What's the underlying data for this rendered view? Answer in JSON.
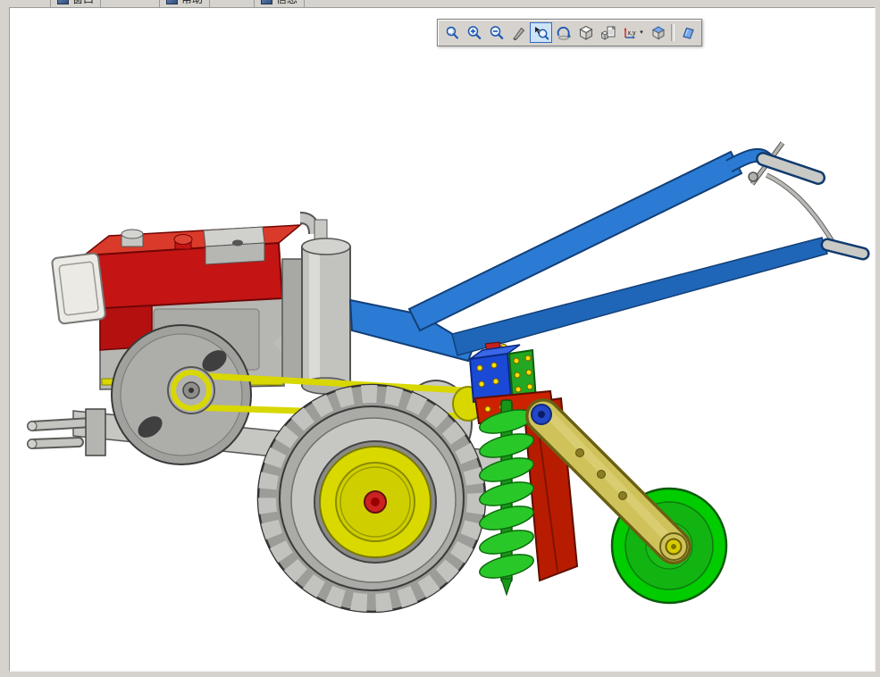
{
  "window": {
    "background": "#d6d3ce",
    "canvas_background": "#ffffff"
  },
  "menu_strip": {
    "items": [
      {
        "label": "窗口"
      },
      {
        "label": "帮助"
      },
      {
        "label": "信息"
      }
    ]
  },
  "toolbar": {
    "axes_icon_text": "x,y",
    "active_icon": "pan",
    "icons": [
      "zoom-window",
      "zoom-in",
      "zoom-out",
      "zoom-dynamic",
      "pan",
      "rotate-view",
      "isometric-view",
      "section-view",
      "axes-display",
      "view-orientation",
      "shaded-display"
    ]
  },
  "model": {
    "name": "walking-tractor-with-auger-and-gauge-wheel",
    "colors": {
      "engine_red": "#c41414",
      "tank_top_red": "#da3a2a",
      "chassis_gray": "#c6c6c2",
      "flywheel_gray": "#a0a09c",
      "belt_yellow": "#d8d800",
      "wheel_hub_yellow": "#d9d900",
      "hub_center_red": "#cc2222",
      "tire_gray": "#9c9c98",
      "handlebar_blue": "#2b7bd4",
      "gearbox_blue": "#1a49d6",
      "gearbox_plate_green": "#22a822",
      "bolt_yellow": "#ffe000",
      "shield_red": "#b81c00",
      "auger_green": "#29c829",
      "arm_khaki": "#cfc25a",
      "tail_wheel_green": "#00cc00",
      "grip_gray": "#c9c9c5"
    }
  }
}
